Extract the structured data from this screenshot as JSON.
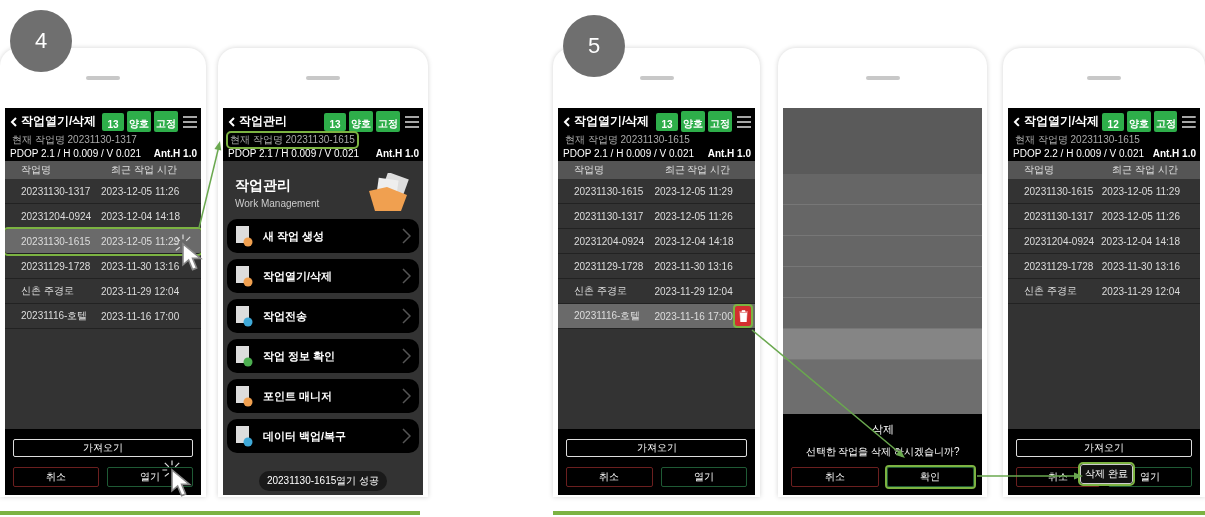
{
  "steps": [
    {
      "number": "4"
    },
    {
      "number": "5"
    }
  ],
  "phones": [
    {
      "kind": "list",
      "title": "작업열기/삭제",
      "badges": [
        "13",
        "양호",
        "고정"
      ],
      "current": "현재 작업명 20231130-1317",
      "current_highlighted": false,
      "pdop": "PDOP 2.1 / H 0.009 / V 0.021",
      "ant": "Ant.H 1.0",
      "columns": [
        "작업명",
        "최근 작업 시간"
      ],
      "rows": [
        {
          "name": "20231130-1317",
          "time": "2023-12-05 11:26",
          "selected": false,
          "highlighted": false,
          "delete_icon": false
        },
        {
          "name": "20231204-0924",
          "time": "2023-12-04 14:18",
          "selected": false,
          "highlighted": false,
          "delete_icon": false
        },
        {
          "name": "20231130-1615",
          "time": "2023-12-05 11:29",
          "selected": true,
          "highlighted": true,
          "delete_icon": false
        },
        {
          "name": "20231129-1728",
          "time": "2023-11-30 13:16",
          "selected": false,
          "highlighted": false,
          "delete_icon": false
        },
        {
          "name": "신촌 주경로",
          "time": "2023-11-29 12:04",
          "selected": false,
          "highlighted": false,
          "delete_icon": false
        },
        {
          "name": "20231116-호텔",
          "time": "2023-11-16 17:00",
          "selected": false,
          "highlighted": false,
          "delete_icon": false
        }
      ],
      "import_button": "가져오기",
      "cancel_button": "취소",
      "open_button": "열기"
    },
    {
      "kind": "menu",
      "title": "작업관리",
      "badges": [
        "13",
        "양호",
        "고정"
      ],
      "current": "현재 작업명 20231130-1615",
      "current_highlighted": true,
      "pdop": "PDOP 2.1 / H 0.009 / V 0.021",
      "ant": "Ant.H 1.0",
      "heading": "작업관리",
      "subheading": "Work Management",
      "items": [
        {
          "label": "새 작업 생성",
          "color": "#f0a050"
        },
        {
          "label": "작업열기/삭제",
          "color": "#f0a050"
        },
        {
          "label": "작업전송",
          "color": "#3fa9d8"
        },
        {
          "label": "작업 정보 확인",
          "color": "#4caf50"
        },
        {
          "label": "포인트 매니저",
          "color": "#f0a050"
        },
        {
          "label": "데이터 백업/복구",
          "color": "#3fa9d8"
        }
      ],
      "toast": "20231130-1615열기 성공"
    },
    {
      "kind": "list",
      "title": "작업열기/삭제",
      "badges": [
        "13",
        "양호",
        "고정"
      ],
      "current": "현재 작업명 20231130-1615",
      "current_highlighted": false,
      "pdop": "PDOP 2.1 / H 0.009 / V 0.021",
      "ant": "Ant.H 1.0",
      "columns": [
        "작업명",
        "최근 작업 시간"
      ],
      "rows": [
        {
          "name": "20231130-1615",
          "time": "2023-12-05 11:29",
          "selected": false,
          "highlighted": false,
          "delete_icon": false
        },
        {
          "name": "20231130-1317",
          "time": "2023-12-05 11:26",
          "selected": false,
          "highlighted": false,
          "delete_icon": false
        },
        {
          "name": "20231204-0924",
          "time": "2023-12-04 14:18",
          "selected": false,
          "highlighted": false,
          "delete_icon": false
        },
        {
          "name": "20231129-1728",
          "time": "2023-11-30 13:16",
          "selected": false,
          "highlighted": false,
          "delete_icon": false
        },
        {
          "name": "신촌 주경로",
          "time": "2023-11-29 12:04",
          "selected": false,
          "highlighted": false,
          "delete_icon": false
        },
        {
          "name": "20231116-호텔",
          "time": "2023-11-16 17:00",
          "selected": true,
          "highlighted": false,
          "delete_icon": true
        }
      ],
      "import_button": "가져오기",
      "cancel_button": "취소",
      "open_button": "열기"
    },
    {
      "kind": "dialog",
      "dialog_title": "삭제",
      "message": "선택한 작업을 삭제 하시겠습니까?",
      "cancel_button": "취소",
      "confirm_button": "확인",
      "confirm_highlighted": true
    },
    {
      "kind": "list",
      "title": "작업열기/삭제",
      "badges": [
        "12",
        "양호",
        "고정"
      ],
      "current": "현재 작업명 20231130-1615",
      "current_highlighted": false,
      "pdop": "PDOP 2.2 / H 0.009 / V 0.021",
      "ant": "Ant.H 1.0",
      "columns": [
        "작업명",
        "최근 작업 시간"
      ],
      "rows": [
        {
          "name": "20231130-1615",
          "time": "2023-12-05 11:29",
          "selected": false,
          "highlighted": false,
          "delete_icon": false
        },
        {
          "name": "20231130-1317",
          "time": "2023-12-05 11:26",
          "selected": false,
          "highlighted": false,
          "delete_icon": false
        },
        {
          "name": "20231204-0924",
          "time": "2023-12-04 14:18",
          "selected": false,
          "highlighted": false,
          "delete_icon": false
        },
        {
          "name": "20231129-1728",
          "time": "2023-11-30 13:16",
          "selected": false,
          "highlighted": false,
          "delete_icon": false
        },
        {
          "name": "신촌 주경로",
          "time": "2023-11-29 12:04",
          "selected": false,
          "highlighted": false,
          "delete_icon": false
        }
      ],
      "import_button": "가져오기",
      "cancel_button": "취소",
      "open_button": "열기",
      "toast": "삭제 완료",
      "toast_highlighted": true
    }
  ]
}
